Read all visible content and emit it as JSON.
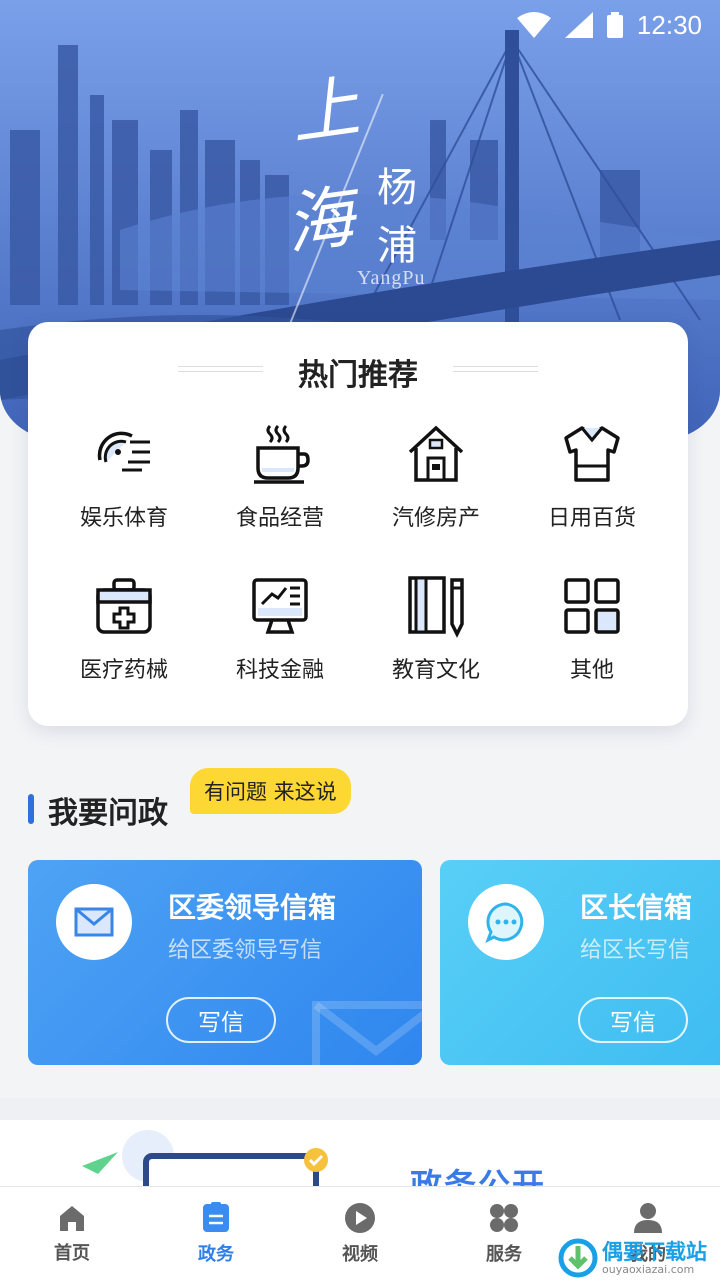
{
  "status_bar": {
    "time": "12:30"
  },
  "banner": {
    "brand_big_1": "上",
    "brand_big_2": "海",
    "brand_small_1": "杨",
    "brand_small_2": "浦",
    "brand_latin": "YangPu"
  },
  "hot": {
    "title": "热门推荐",
    "items": [
      {
        "label": "娱乐体育",
        "icon": "sports-ball-icon"
      },
      {
        "label": "食品经营",
        "icon": "coffee-cup-icon"
      },
      {
        "label": "汽修房产",
        "icon": "house-icon"
      },
      {
        "label": "日用百货",
        "icon": "shirt-icon"
      },
      {
        "label": "医疗药械",
        "icon": "medical-kit-icon"
      },
      {
        "label": "科技金融",
        "icon": "monitor-chart-icon"
      },
      {
        "label": "教育文化",
        "icon": "book-pencil-icon"
      },
      {
        "label": "其他",
        "icon": "grid-icon"
      }
    ]
  },
  "wenzheng": {
    "title": "我要问政",
    "bubble": "有问题 来这说",
    "cards": [
      {
        "title": "区委领导信箱",
        "subtitle": "给区委领导写信",
        "button": "写信",
        "icon": "envelope-icon"
      },
      {
        "title": "区长信箱",
        "subtitle": "给区长写信",
        "button": "写信",
        "icon": "chat-bubble-icon"
      }
    ]
  },
  "open_section": {
    "title": "政务公开"
  },
  "tabbar": {
    "tabs": [
      {
        "label": "首页",
        "icon": "home-icon"
      },
      {
        "label": "政务",
        "icon": "document-icon"
      },
      {
        "label": "视频",
        "icon": "play-icon"
      },
      {
        "label": "服务",
        "icon": "services-icon"
      },
      {
        "label": "我的",
        "icon": "user-icon"
      }
    ],
    "active_index": 1
  },
  "watermark": {
    "text": "偶要下载站",
    "sub": "ouyaoxiazai.com"
  },
  "colors": {
    "accent": "#2f7fe8",
    "bubble": "#fdd835",
    "card1": "#3a92f0",
    "card2": "#45c2f2"
  }
}
